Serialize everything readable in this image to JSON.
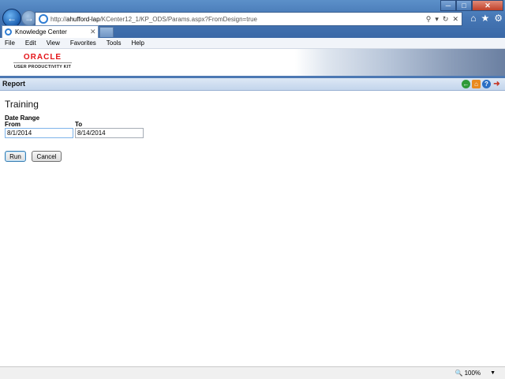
{
  "browser": {
    "url_prefix": "http://",
    "url_host": "ahufford-lap",
    "url_path": "/KCenter12_1/KP_ODS/Params.aspx?FromDesign=true",
    "tab_label": "Knowledge Center",
    "menu": [
      "File",
      "Edit",
      "View",
      "Favorites",
      "Tools",
      "Help"
    ],
    "zoom": "100%"
  },
  "logo": {
    "word": "ORACLE",
    "sub": "USER PRODUCTIVITY KIT"
  },
  "header": {
    "title": "Report"
  },
  "form": {
    "title": "Training",
    "section_label": "Date Range",
    "from_label": "From",
    "from_value": "8/1/2014",
    "to_label": "To",
    "to_value": "8/14/2014",
    "run_label": "Run",
    "cancel_label": "Cancel"
  },
  "colors": {
    "accent": "#4c78b3",
    "oracle_red": "#e4151a"
  }
}
